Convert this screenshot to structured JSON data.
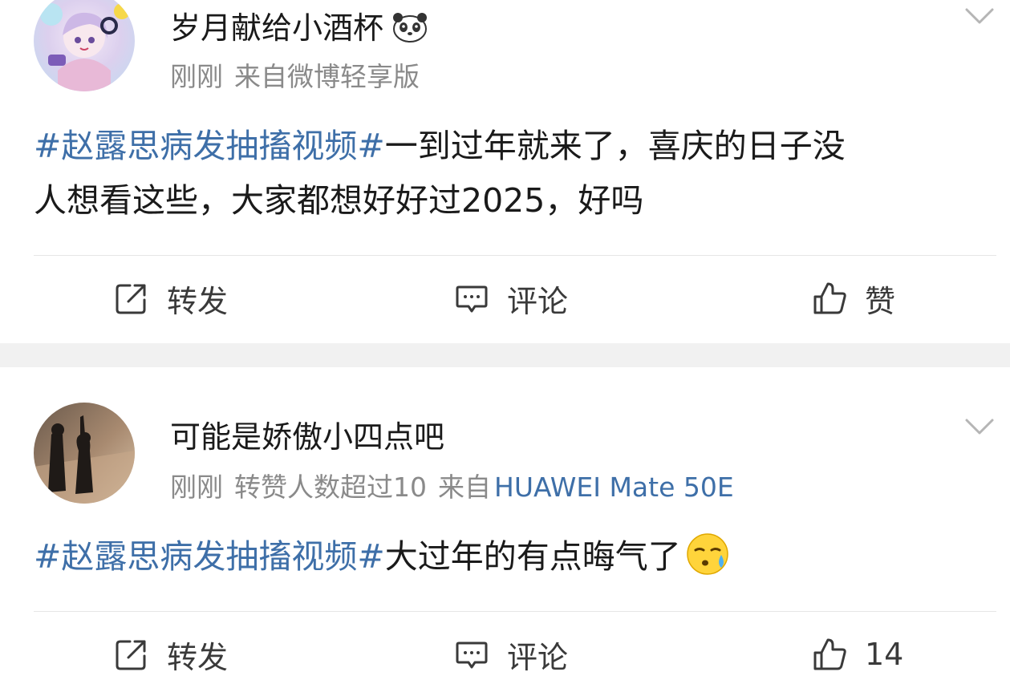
{
  "posts": [
    {
      "username": "岁月献给小酒杯",
      "username_badge_icon": "panda-icon",
      "time": "刚刚",
      "repost_note": "",
      "source_prefix": "来自",
      "source": "微博轻享版",
      "hashtag": "#赵露思病发抽搐视频#",
      "text_line1": "一到过年就来了，喜庆的日子没",
      "text_line2": "人想看这些，大家都想好好过2025，好吗",
      "actions": {
        "repost_label": "转发",
        "comment_label": "评论",
        "like_label": "赞"
      }
    },
    {
      "username": "可能是娇傲小四点吧",
      "time": "刚刚",
      "repost_note": "转赞人数超过10",
      "source_prefix": "来自",
      "source": "HUAWEI Mate 50E",
      "hashtag": "#赵露思病发抽搐视频#",
      "text": "大过年的有点晦气了",
      "trailing_emoji_icon": "sweat-face-icon",
      "actions": {
        "repost_label": "转发",
        "comment_label": "评论",
        "like_label": "14"
      }
    }
  ],
  "colors": {
    "hashtag": "#3e6fa8",
    "meta": "#8a8a8a",
    "separator": "#f1f1f1"
  }
}
